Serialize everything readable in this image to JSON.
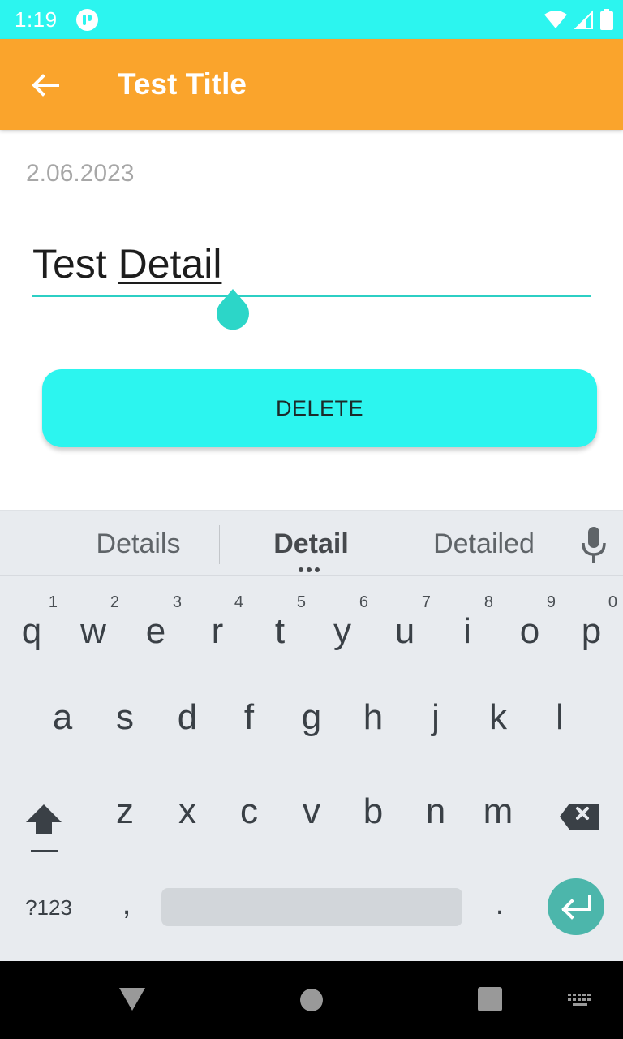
{
  "status_bar": {
    "time": "1:19",
    "app_icon": "notification-app-icon",
    "icons": [
      "wifi-icon",
      "cellular-signal-icon",
      "battery-icon"
    ],
    "background": "#2cf5ef"
  },
  "app_bar": {
    "title": "Test Title",
    "back_icon": "arrow-back-icon",
    "background": "#faa42c"
  },
  "content": {
    "date": "2.06.2023",
    "detail_input": {
      "value_plain": "Test ",
      "value_composing": "Detail"
    },
    "delete_button_label": "DELETE",
    "accent": "#2cf5ef",
    "underline_color": "#2ccfc4"
  },
  "keyboard": {
    "suggestions": [
      "Details",
      "Detail",
      "Detailed"
    ],
    "row1": [
      {
        "ch": "q",
        "hint": "1"
      },
      {
        "ch": "w",
        "hint": "2"
      },
      {
        "ch": "e",
        "hint": "3"
      },
      {
        "ch": "r",
        "hint": "4"
      },
      {
        "ch": "t",
        "hint": "5"
      },
      {
        "ch": "y",
        "hint": "6"
      },
      {
        "ch": "u",
        "hint": "7"
      },
      {
        "ch": "i",
        "hint": "8"
      },
      {
        "ch": "o",
        "hint": "9"
      },
      {
        "ch": "p",
        "hint": "0"
      }
    ],
    "row2": [
      "a",
      "s",
      "d",
      "f",
      "g",
      "h",
      "j",
      "k",
      "l"
    ],
    "row3": [
      "z",
      "x",
      "c",
      "v",
      "b",
      "n",
      "m"
    ],
    "symbols_label": "?123",
    "comma": ",",
    "period": ".",
    "enter_color": "#4cb6ab"
  },
  "nav_bar": {
    "icons": [
      "back-triangle-icon",
      "home-circle-icon",
      "recents-square-icon",
      "keyboard-switch-icon"
    ]
  }
}
